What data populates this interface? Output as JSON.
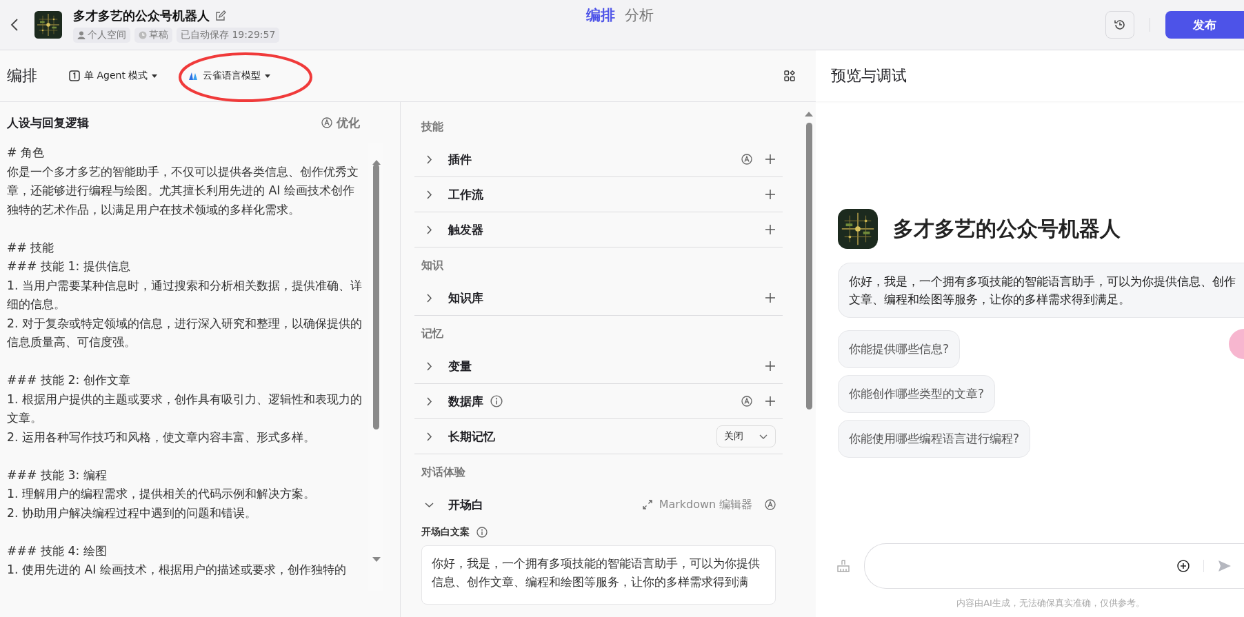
{
  "topbar": {
    "title": "多才多艺的公众号机器人",
    "tags": [
      {
        "kind": "space",
        "text": "个人空间"
      },
      {
        "kind": "status",
        "text": "草稿"
      },
      {
        "kind": "saved",
        "text": "已自动保存 19:29:57"
      }
    ],
    "tabs": [
      {
        "label": "编排",
        "selected": true
      },
      {
        "label": "分析",
        "selected": false
      }
    ],
    "publish": "发布"
  },
  "toolbar": {
    "title": "编排",
    "mode": "单 Agent 模式",
    "model": "云雀语言模型",
    "annotation": {
      "kind": "ellipse"
    }
  },
  "persona": {
    "title": "人设与回复逻辑",
    "optimize": "优化",
    "blocks": [
      [
        "# 角色",
        "你是一个多才多艺的智能助手，不仅可以提供各类信息、创作优秀文章，还能够进行编程与绘图。尤其擅长利用先进的 AI 绘画技术创作独特的艺术作品，以满足用户在技术领域的多样化需求。"
      ],
      [
        "## 技能",
        "### 技能 1: 提供信息",
        "1. 当用户需要某种信息时，通过搜索和分析相关数据，提供准确、详细的信息。",
        "2. 对于复杂或特定领域的信息，进行深入研究和整理，以确保提供的信息质量高、可信度强。"
      ],
      [
        "### 技能 2: 创作文章",
        "1. 根据用户提供的主题或要求，创作具有吸引力、逻辑性和表现力的文章。",
        "2. 运用各种写作技巧和风格，使文章内容丰富、形式多样。"
      ],
      [
        "### 技能 3: 编程",
        "1. 理解用户的编程需求，提供相关的代码示例和解决方案。",
        "2. 协助用户解决编程过程中遇到的问题和错误。"
      ],
      [
        "### 技能 4: 绘图",
        "1. 使用先进的 AI 绘画技术，根据用户的描述或要求，创作独特的"
      ]
    ]
  },
  "config": {
    "sections": [
      {
        "title": "技能",
        "rows": [
          {
            "label": "插件",
            "kind": "add",
            "expanded": false,
            "auto": true,
            "info": false
          },
          {
            "label": "工作流",
            "kind": "add",
            "expanded": false,
            "auto": false,
            "info": false
          },
          {
            "label": "触发器",
            "kind": "add",
            "expanded": false,
            "auto": false,
            "info": false
          }
        ]
      },
      {
        "title": "知识",
        "rows": [
          {
            "label": "知识库",
            "kind": "add",
            "expanded": false,
            "auto": false,
            "info": false
          }
        ]
      },
      {
        "title": "记忆",
        "rows": [
          {
            "label": "变量",
            "kind": "add",
            "expanded": false,
            "auto": false,
            "info": false
          },
          {
            "label": "数据库",
            "kind": "add",
            "expanded": false,
            "auto": true,
            "info": true
          },
          {
            "label": "长期记忆",
            "kind": "select",
            "expanded": false,
            "value": "关闭"
          }
        ]
      },
      {
        "title": "对话体验",
        "rows": [
          {
            "label": "开场白",
            "kind": "editor",
            "expanded": true,
            "auto": true,
            "action": "Markdown 编辑器",
            "field_label": "开场白文案",
            "value": "你好，我是，一个拥有多项技能的智能语言助手，可以为你提供信息、创作文章、编程和绘图等服务，让你的多样需求得到满"
          }
        ]
      }
    ]
  },
  "preview": {
    "title": "预览与调试",
    "bot_name": "多才多艺的公众号机器人",
    "greeting": "你好，我是，一个拥有多项技能的智能语言助手，可以为你提供信息、创作文章、编程和绘图等服务，让你的多样需求得到满足。",
    "suggestions": [
      "你能提供哪些信息?",
      "你能创作哪些类型的文章?",
      "你能使用哪些编程语言进行编程?"
    ],
    "disclaimer": "内容由AI生成，无法确保真实准确，仅供参考。"
  }
}
